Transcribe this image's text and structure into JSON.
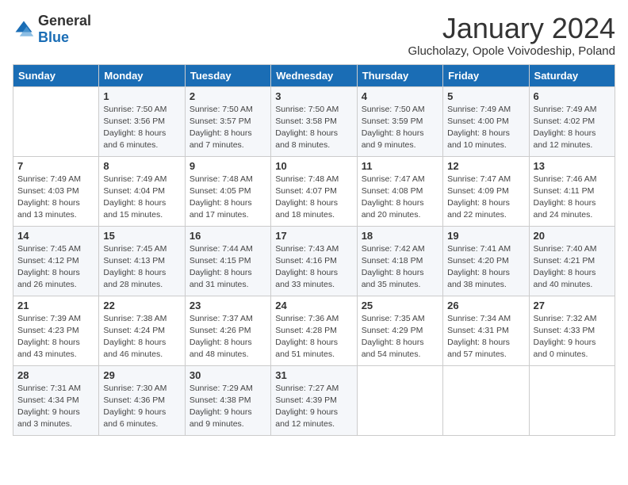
{
  "header": {
    "logo_general": "General",
    "logo_blue": "Blue",
    "title": "January 2024",
    "subtitle": "Glucholazy, Opole Voivodeship, Poland"
  },
  "days_of_week": [
    "Sunday",
    "Monday",
    "Tuesday",
    "Wednesday",
    "Thursday",
    "Friday",
    "Saturday"
  ],
  "weeks": [
    [
      {
        "day": "",
        "info": ""
      },
      {
        "day": "1",
        "info": "Sunrise: 7:50 AM\nSunset: 3:56 PM\nDaylight: 8 hours\nand 6 minutes."
      },
      {
        "day": "2",
        "info": "Sunrise: 7:50 AM\nSunset: 3:57 PM\nDaylight: 8 hours\nand 7 minutes."
      },
      {
        "day": "3",
        "info": "Sunrise: 7:50 AM\nSunset: 3:58 PM\nDaylight: 8 hours\nand 8 minutes."
      },
      {
        "day": "4",
        "info": "Sunrise: 7:50 AM\nSunset: 3:59 PM\nDaylight: 8 hours\nand 9 minutes."
      },
      {
        "day": "5",
        "info": "Sunrise: 7:49 AM\nSunset: 4:00 PM\nDaylight: 8 hours\nand 10 minutes."
      },
      {
        "day": "6",
        "info": "Sunrise: 7:49 AM\nSunset: 4:02 PM\nDaylight: 8 hours\nand 12 minutes."
      }
    ],
    [
      {
        "day": "7",
        "info": "Sunrise: 7:49 AM\nSunset: 4:03 PM\nDaylight: 8 hours\nand 13 minutes."
      },
      {
        "day": "8",
        "info": "Sunrise: 7:49 AM\nSunset: 4:04 PM\nDaylight: 8 hours\nand 15 minutes."
      },
      {
        "day": "9",
        "info": "Sunrise: 7:48 AM\nSunset: 4:05 PM\nDaylight: 8 hours\nand 17 minutes."
      },
      {
        "day": "10",
        "info": "Sunrise: 7:48 AM\nSunset: 4:07 PM\nDaylight: 8 hours\nand 18 minutes."
      },
      {
        "day": "11",
        "info": "Sunrise: 7:47 AM\nSunset: 4:08 PM\nDaylight: 8 hours\nand 20 minutes."
      },
      {
        "day": "12",
        "info": "Sunrise: 7:47 AM\nSunset: 4:09 PM\nDaylight: 8 hours\nand 22 minutes."
      },
      {
        "day": "13",
        "info": "Sunrise: 7:46 AM\nSunset: 4:11 PM\nDaylight: 8 hours\nand 24 minutes."
      }
    ],
    [
      {
        "day": "14",
        "info": "Sunrise: 7:45 AM\nSunset: 4:12 PM\nDaylight: 8 hours\nand 26 minutes."
      },
      {
        "day": "15",
        "info": "Sunrise: 7:45 AM\nSunset: 4:13 PM\nDaylight: 8 hours\nand 28 minutes."
      },
      {
        "day": "16",
        "info": "Sunrise: 7:44 AM\nSunset: 4:15 PM\nDaylight: 8 hours\nand 31 minutes."
      },
      {
        "day": "17",
        "info": "Sunrise: 7:43 AM\nSunset: 4:16 PM\nDaylight: 8 hours\nand 33 minutes."
      },
      {
        "day": "18",
        "info": "Sunrise: 7:42 AM\nSunset: 4:18 PM\nDaylight: 8 hours\nand 35 minutes."
      },
      {
        "day": "19",
        "info": "Sunrise: 7:41 AM\nSunset: 4:20 PM\nDaylight: 8 hours\nand 38 minutes."
      },
      {
        "day": "20",
        "info": "Sunrise: 7:40 AM\nSunset: 4:21 PM\nDaylight: 8 hours\nand 40 minutes."
      }
    ],
    [
      {
        "day": "21",
        "info": "Sunrise: 7:39 AM\nSunset: 4:23 PM\nDaylight: 8 hours\nand 43 minutes."
      },
      {
        "day": "22",
        "info": "Sunrise: 7:38 AM\nSunset: 4:24 PM\nDaylight: 8 hours\nand 46 minutes."
      },
      {
        "day": "23",
        "info": "Sunrise: 7:37 AM\nSunset: 4:26 PM\nDaylight: 8 hours\nand 48 minutes."
      },
      {
        "day": "24",
        "info": "Sunrise: 7:36 AM\nSunset: 4:28 PM\nDaylight: 8 hours\nand 51 minutes."
      },
      {
        "day": "25",
        "info": "Sunrise: 7:35 AM\nSunset: 4:29 PM\nDaylight: 8 hours\nand 54 minutes."
      },
      {
        "day": "26",
        "info": "Sunrise: 7:34 AM\nSunset: 4:31 PM\nDaylight: 8 hours\nand 57 minutes."
      },
      {
        "day": "27",
        "info": "Sunrise: 7:32 AM\nSunset: 4:33 PM\nDaylight: 9 hours\nand 0 minutes."
      }
    ],
    [
      {
        "day": "28",
        "info": "Sunrise: 7:31 AM\nSunset: 4:34 PM\nDaylight: 9 hours\nand 3 minutes."
      },
      {
        "day": "29",
        "info": "Sunrise: 7:30 AM\nSunset: 4:36 PM\nDaylight: 9 hours\nand 6 minutes."
      },
      {
        "day": "30",
        "info": "Sunrise: 7:29 AM\nSunset: 4:38 PM\nDaylight: 9 hours\nand 9 minutes."
      },
      {
        "day": "31",
        "info": "Sunrise: 7:27 AM\nSunset: 4:39 PM\nDaylight: 9 hours\nand 12 minutes."
      },
      {
        "day": "",
        "info": ""
      },
      {
        "day": "",
        "info": ""
      },
      {
        "day": "",
        "info": ""
      }
    ]
  ]
}
